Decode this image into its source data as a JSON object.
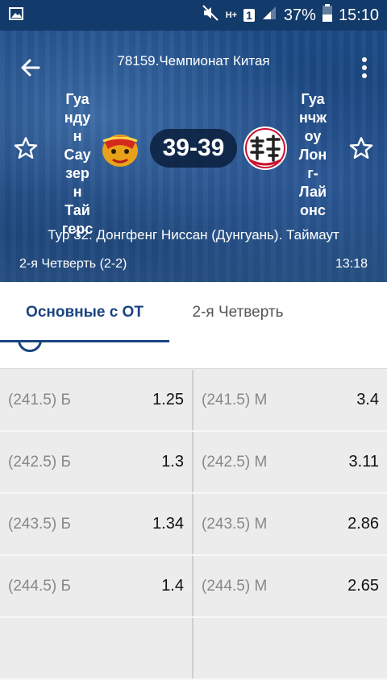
{
  "status_bar": {
    "battery": "37%",
    "time": "15:10",
    "network": "H+",
    "sim": "1"
  },
  "header": {
    "league": "78159.Чемпионат Китая",
    "home_team": "Гуа\nнду\nн\nСау\nзер\nн\nТай\nгерс",
    "away_team": "Гуа\nнчж\nоу\nЛон\nг-\nЛай\nонс",
    "score": "39-39",
    "tour_info": "Тур 32. Донгфенг Ниссан (Дунгуань). Таймаут",
    "period": "2-я  Четверть (2-2)",
    "clock": "13:18"
  },
  "tabs": [
    {
      "label": "Основные с ОТ",
      "active": true
    },
    {
      "label": "2-я  Четверть",
      "active": false
    }
  ],
  "markets": [
    {
      "left_label": "(241.5) Б",
      "left_odd": "1.25",
      "right_label": "(241.5) М",
      "right_odd": "3.4"
    },
    {
      "left_label": "(242.5) Б",
      "left_odd": "1.3",
      "right_label": "(242.5) М",
      "right_odd": "3.11"
    },
    {
      "left_label": "(243.5) Б",
      "left_odd": "1.34",
      "right_label": "(243.5) М",
      "right_odd": "2.86"
    },
    {
      "left_label": "(244.5) Б",
      "left_odd": "1.4",
      "right_label": "(244.5) М",
      "right_odd": "2.65"
    }
  ],
  "colors": {
    "accent": "#1a4480",
    "hero": "#1a447c"
  }
}
